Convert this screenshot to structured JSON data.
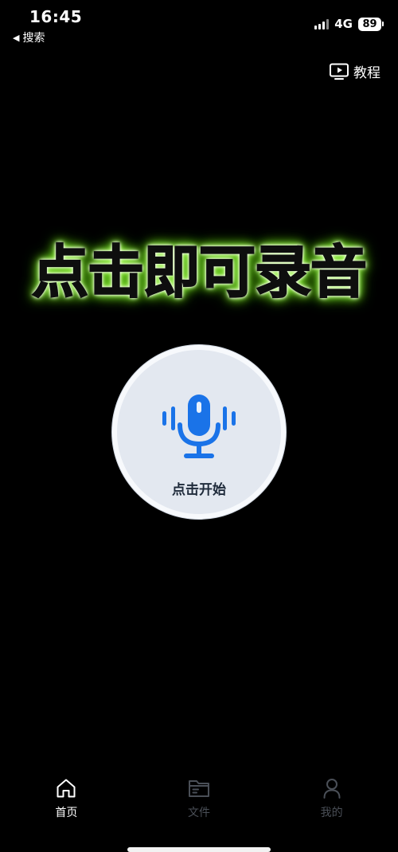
{
  "status_bar": {
    "time": "16:45",
    "back_label": "搜索",
    "network": "4G",
    "battery": "89"
  },
  "header": {
    "tutorial_label": "教程"
  },
  "main": {
    "headline": "点击即可录音",
    "record_label": "点击开始"
  },
  "bottom_nav": {
    "items": [
      {
        "label": "首页",
        "active": true
      },
      {
        "label": "文件",
        "active": false
      },
      {
        "label": "我的",
        "active": false
      }
    ]
  },
  "colors": {
    "background": "#000000",
    "accent_blue": "#1a73e8",
    "headline_glow": "#7de81f",
    "inactive_nav": "#4a4f57"
  },
  "icons": [
    "tutorial-play-icon",
    "microphone-icon",
    "home-icon",
    "folder-icon",
    "profile-icon"
  ]
}
